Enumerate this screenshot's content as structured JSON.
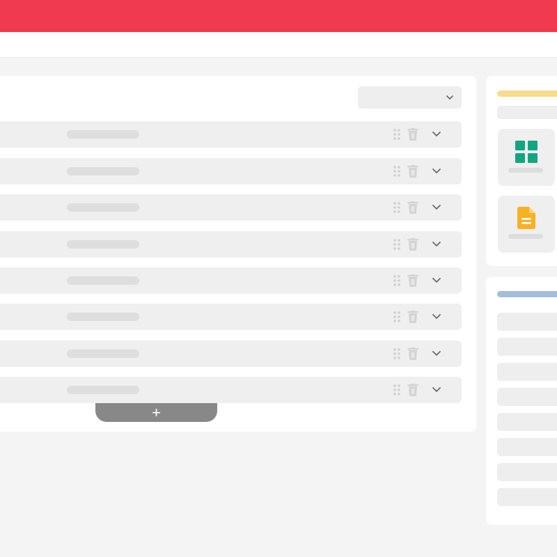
{
  "theme": {
    "header_color": "#f03a4f",
    "grid_icon_color": "#13a582",
    "doc_icon_color": "#f7b125",
    "yellow_accent": "#f7dc8b",
    "blue_accent": "#a3bedb"
  },
  "icons": {
    "select_chevron": "chevron-down-icon",
    "row_drag": "drag-handle-icon",
    "row_delete": "trash-icon",
    "row_expand": "chevron-down-icon",
    "add": "plus-icon",
    "widget_1": "grid-icon",
    "widget_2": "document-icon"
  },
  "add_button": {
    "label": "+"
  }
}
